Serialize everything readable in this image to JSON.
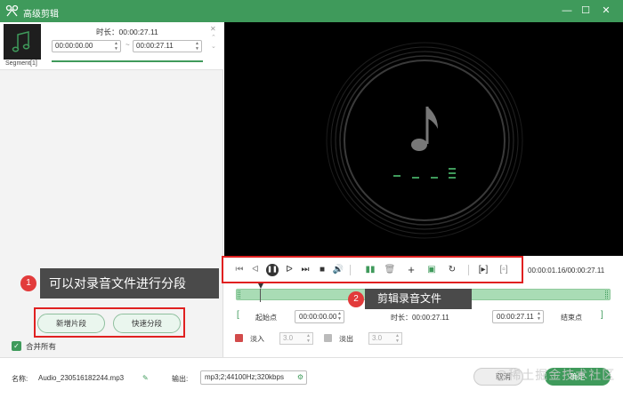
{
  "window": {
    "title": "高级剪辑",
    "minimize": "—",
    "maximize": "☐",
    "close": "✕"
  },
  "segment": {
    "label": "Segment[1]",
    "duration": "时长：00:00:27.11",
    "start": "00:00:00.00",
    "end": "00:00:27.11",
    "tilde": "~",
    "close": "✕",
    "up": "⌃",
    "down": "⌄"
  },
  "callout_left": {
    "number": "1",
    "text": "可以对录音文件进行分段"
  },
  "buttons": {
    "add_segment": "新增片段",
    "quick_split": "快速分段"
  },
  "merge_all": "合并所有",
  "player": {
    "timecode": "00:00:01.16/00:00:27.11"
  },
  "callout_right": {
    "number": "2",
    "text": "剪辑录音文件"
  },
  "trim": {
    "start_label": "起始点",
    "start_value": "00:00:00.00",
    "duration": "时长：00:00:27.11",
    "end_value": "00:00:27.11",
    "end_label": "结束点"
  },
  "fade": {
    "in_label": "淡入",
    "in_value": "3.0",
    "out_label": "淡出",
    "out_value": "3.0"
  },
  "bottom": {
    "name_label": "名称:",
    "file_name": "Audio_230516182244.mp3",
    "output_label": "输出:",
    "output_value": "mp3;2;44100Hz;320kbps",
    "cancel": "取消",
    "ok": "确定"
  },
  "watermark": "@稀土掘金技术社区",
  "colors": {
    "accent": "#3f9a5b",
    "highlight": "#e02020",
    "callout_bg": "#4a4a4a"
  }
}
